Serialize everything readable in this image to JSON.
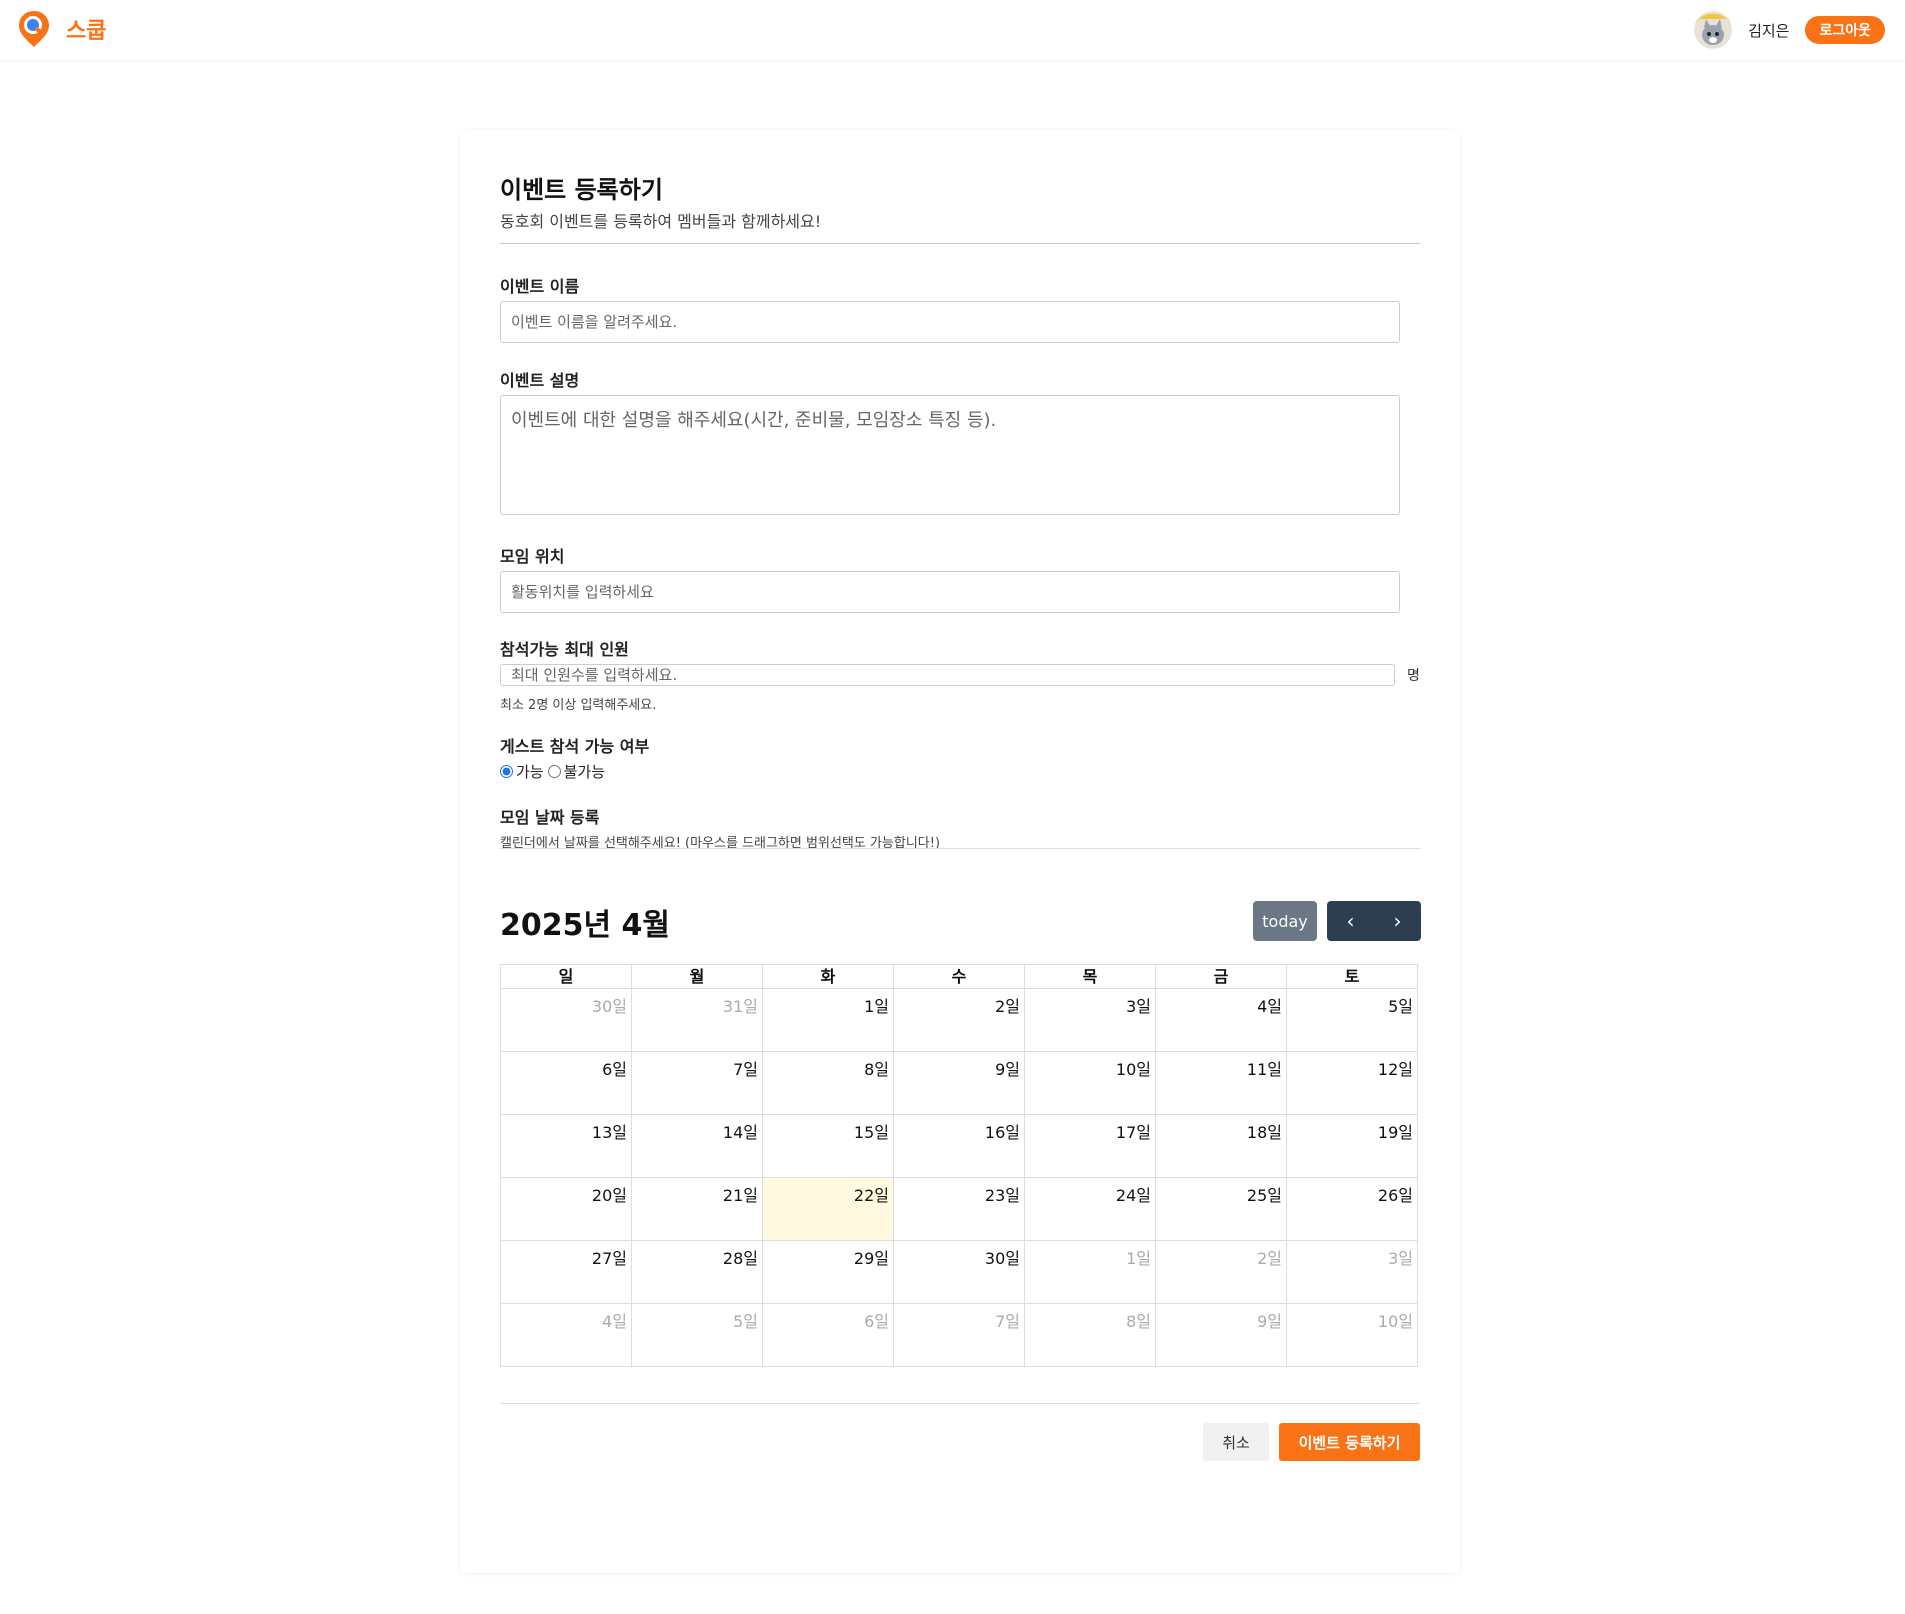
{
  "header": {
    "brand": "스쿱",
    "user_name": "김지은",
    "logout_label": "로그아웃"
  },
  "form": {
    "title": "이벤트 등록하기",
    "subtitle": "동호회 이벤트를 등록하여 멤버들과 함께하세요!",
    "name_label": "이벤트 이름",
    "name_placeholder": "이벤트 이름을 알려주세요.",
    "desc_label": "이벤트 설명",
    "desc_placeholder": "이벤트에 대한 설명을 해주세요(시간, 준비물, 모임장소 특징 등).",
    "location_label": "모임 위치",
    "location_placeholder": "활동위치를 입력하세요",
    "max_label": "참석가능 최대 인원",
    "max_placeholder": "최대 인원수를 입력하세요.",
    "max_unit": "명",
    "max_hint": "최소 2명 이상 입력해주세요.",
    "guest_label": "게스트 참석 가능 여부",
    "guest_options": [
      "가능",
      "불가능"
    ],
    "guest_selected": "가능",
    "date_label": "모임 날짜 등록",
    "date_hint": "캘린더에서 날짜를 선택해주세요! (마우스를 드래그하면 범위선택도 가능합니다!)",
    "cancel_label": "취소",
    "submit_label": "이벤트 등록하기"
  },
  "calendar": {
    "title": "2025년 4월",
    "today_label": "today",
    "weekdays": [
      "일",
      "월",
      "화",
      "수",
      "목",
      "금",
      "토"
    ],
    "today_date": "22일",
    "weeks": [
      [
        {
          "d": "30일",
          "o": true
        },
        {
          "d": "31일",
          "o": true
        },
        {
          "d": "1일"
        },
        {
          "d": "2일"
        },
        {
          "d": "3일"
        },
        {
          "d": "4일"
        },
        {
          "d": "5일"
        }
      ],
      [
        {
          "d": "6일"
        },
        {
          "d": "7일"
        },
        {
          "d": "8일"
        },
        {
          "d": "9일"
        },
        {
          "d": "10일"
        },
        {
          "d": "11일"
        },
        {
          "d": "12일"
        }
      ],
      [
        {
          "d": "13일"
        },
        {
          "d": "14일"
        },
        {
          "d": "15일"
        },
        {
          "d": "16일"
        },
        {
          "d": "17일"
        },
        {
          "d": "18일"
        },
        {
          "d": "19일"
        }
      ],
      [
        {
          "d": "20일"
        },
        {
          "d": "21일"
        },
        {
          "d": "22일",
          "t": true
        },
        {
          "d": "23일"
        },
        {
          "d": "24일"
        },
        {
          "d": "25일"
        },
        {
          "d": "26일"
        }
      ],
      [
        {
          "d": "27일"
        },
        {
          "d": "28일"
        },
        {
          "d": "29일"
        },
        {
          "d": "30일"
        },
        {
          "d": "1일",
          "o": true
        },
        {
          "d": "2일",
          "o": true
        },
        {
          "d": "3일",
          "o": true
        }
      ],
      [
        {
          "d": "4일",
          "o": true
        },
        {
          "d": "5일",
          "o": true
        },
        {
          "d": "6일",
          "o": true
        },
        {
          "d": "7일",
          "o": true
        },
        {
          "d": "8일",
          "o": true
        },
        {
          "d": "9일",
          "o": true
        },
        {
          "d": "10일",
          "o": true
        }
      ]
    ]
  },
  "colors": {
    "brand": "#f97316",
    "today_bg": "#fffadf",
    "nav_bg": "#2c3e50",
    "today_btn_bg": "#6b7785"
  }
}
